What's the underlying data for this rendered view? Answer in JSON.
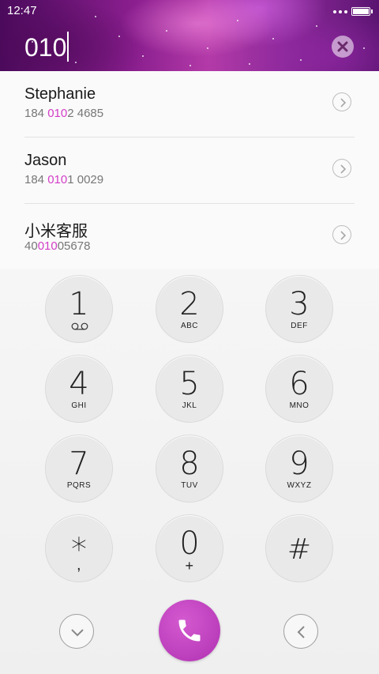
{
  "status_bar": {
    "time": "12:47"
  },
  "dialer": {
    "input_value": "010"
  },
  "results": [
    {
      "name": "Stephanie",
      "number_before": "184 ",
      "number_match": "010",
      "number_after": "2 4685"
    },
    {
      "name": "Jason",
      "number_before": "184 ",
      "number_match": "010",
      "number_after": "1 0029"
    },
    {
      "name": "小米客服",
      "number_before": "40",
      "number_match": "010",
      "number_after": "05678"
    }
  ],
  "keypad": {
    "keys": [
      {
        "digit": "1",
        "letters": ""
      },
      {
        "digit": "2",
        "letters": "ABC"
      },
      {
        "digit": "3",
        "letters": "DEF"
      },
      {
        "digit": "4",
        "letters": "GHI"
      },
      {
        "digit": "5",
        "letters": "JKL"
      },
      {
        "digit": "6",
        "letters": "MNO"
      },
      {
        "digit": "7",
        "letters": "PQRS"
      },
      {
        "digit": "8",
        "letters": "TUV"
      },
      {
        "digit": "9",
        "letters": "WXYZ"
      },
      {
        "digit": "*",
        "letters": ","
      },
      {
        "digit": "0",
        "letters": "+"
      },
      {
        "digit": "#",
        "letters": ""
      }
    ]
  },
  "colors": {
    "accent": "#d33ec8",
    "call_button": "#b534b6"
  },
  "icons": {
    "clear": "close-icon",
    "detail": "chevron-right-icon",
    "voicemail": "voicemail-icon",
    "collapse": "chevron-down-icon",
    "backspace": "chevron-left-icon",
    "call": "phone-icon"
  }
}
